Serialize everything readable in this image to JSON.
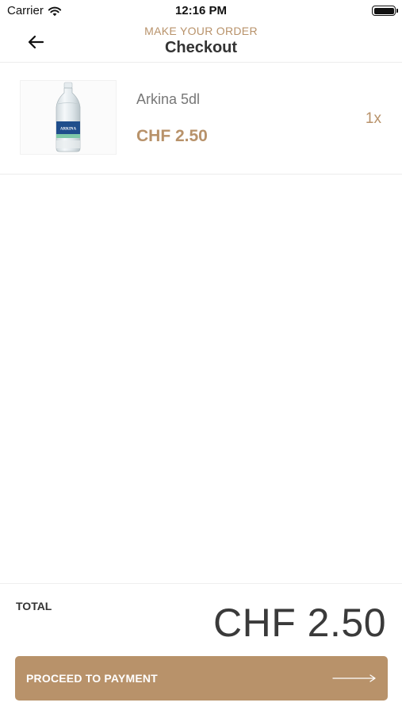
{
  "status_bar": {
    "carrier": "Carrier",
    "time": "12:16 PM"
  },
  "header": {
    "subtitle": "MAKE YOUR ORDER",
    "title": "Checkout"
  },
  "cart": {
    "items": [
      {
        "name": "Arkina 5dl",
        "price": "CHF 2.50",
        "quantity": "1x",
        "image_label": "ARKINA"
      }
    ]
  },
  "footer": {
    "total_label": "TOTAL",
    "total_amount": "CHF 2.50",
    "pay_button_label": "PROCEED TO PAYMENT"
  },
  "colors": {
    "accent": "#b8926a",
    "title_text": "#333333",
    "muted_text": "#777777"
  },
  "icons": {
    "back": "arrow-left-icon",
    "pay": "long-arrow-right-icon",
    "wifi": "wifi-icon",
    "battery": "battery-icon"
  }
}
